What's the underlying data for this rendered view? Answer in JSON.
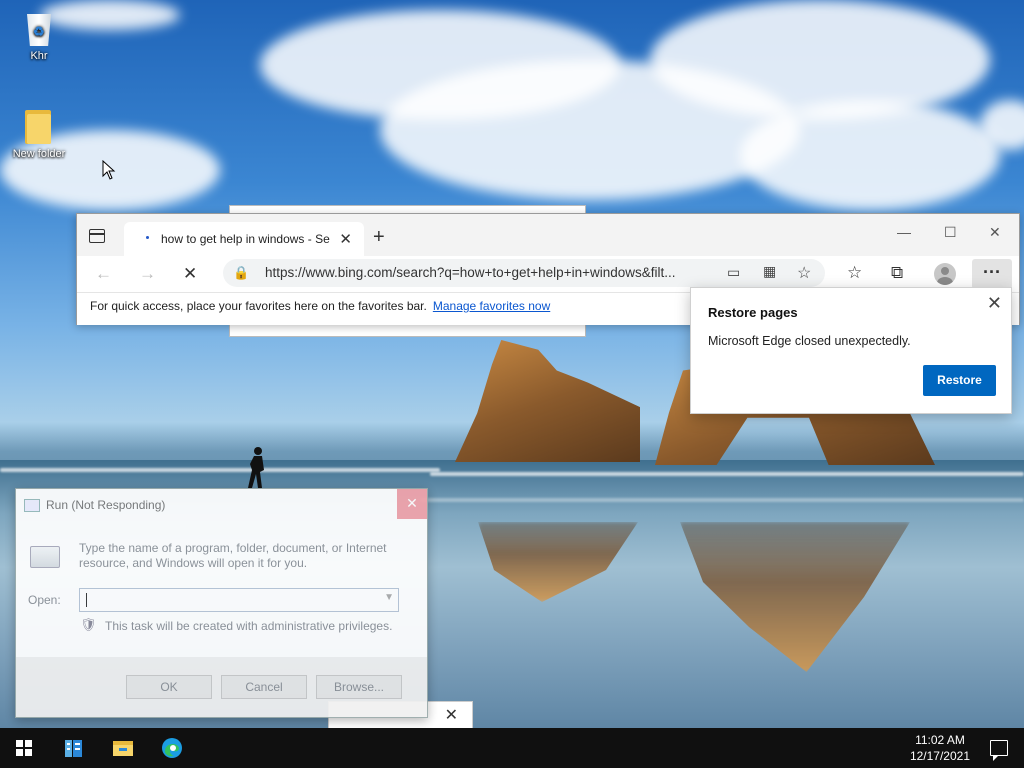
{
  "desktop": {
    "icons": [
      {
        "label": "Khr",
        "icon": "recycle-bin-icon"
      },
      {
        "label": "New folder",
        "icon": "folder-icon"
      }
    ]
  },
  "edge": {
    "tab_title": "how to get help in windows - Se",
    "url": "https://www.bing.com/search?q=how+to+get+help+in+windows&filt...",
    "favbar_text": "For quick access, place your favorites here on the favorites bar.",
    "favbar_link": "Manage favorites now",
    "restore_popup": {
      "title": "Restore pages",
      "body": "Microsoft Edge closed unexpectedly.",
      "button": "Restore"
    }
  },
  "run_dialog": {
    "title": "Run (Not Responding)",
    "description": "Type the name of a program, folder, document, or Internet resource, and Windows will open it for you.",
    "open_label": "Open:",
    "open_value": "",
    "admin_note": "This task will be created with administrative privileges.",
    "ok": "OK",
    "cancel": "Cancel",
    "browse": "Browse..."
  },
  "taskbar": {
    "time": "11:02 AM",
    "date": "12/17/2021",
    "apps": [
      "server-manager-icon",
      "file-explorer-icon",
      "edge-icon"
    ]
  }
}
